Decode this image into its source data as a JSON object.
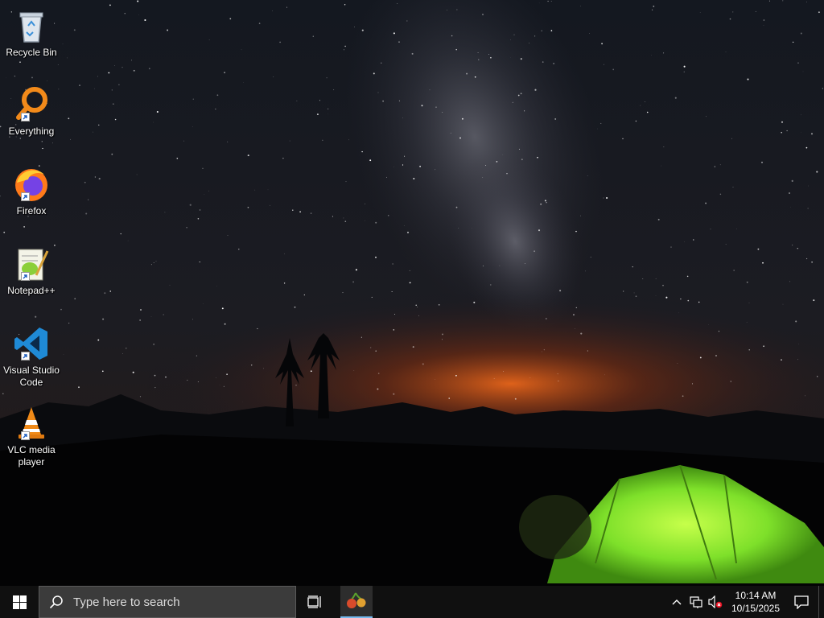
{
  "desktop": {
    "icons": [
      {
        "label": "Recycle Bin",
        "icon": "recycle-bin-icon"
      },
      {
        "label": "Everything",
        "icon": "everything-search-icon"
      },
      {
        "label": "Firefox",
        "icon": "firefox-icon"
      },
      {
        "label": "Notepad++",
        "icon": "notepad-plus-plus-icon"
      },
      {
        "label": "Visual Studio Code",
        "icon": "vscode-icon"
      },
      {
        "label": "VLC media player",
        "icon": "vlc-icon"
      }
    ]
  },
  "taskbar": {
    "search_placeholder": "Type here to search",
    "pinned_app_icon": "cherry-app-icon",
    "tray": {
      "chevron_icon": "chevron-up-icon",
      "network_icon": "network-icon",
      "volume_icon": "volume-muted-icon",
      "time": "10:14 AM",
      "date": "10/15/2025",
      "notification_icon": "action-center-icon"
    }
  },
  "colors": {
    "taskbar_bg": "#101010",
    "search_bg": "#3b3b3b",
    "accent": "#76b9ed",
    "tent_green": "#7ee02a"
  }
}
